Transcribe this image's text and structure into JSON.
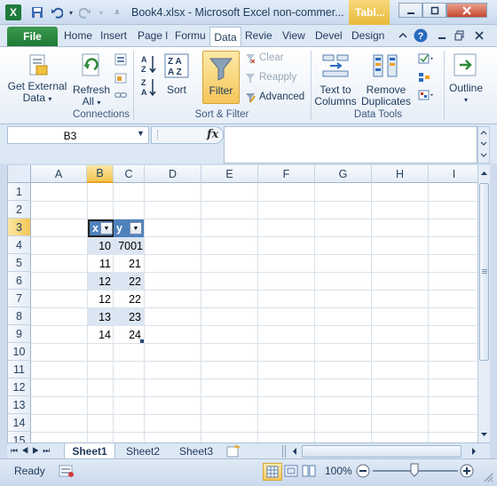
{
  "window": {
    "title": "Book4.xlsx - Microsoft Excel non-commer...",
    "context_tab": "Tabl...",
    "app_icon_letter": "X"
  },
  "tabs": {
    "file": "File",
    "items": [
      "Home",
      "Insert",
      "Page l",
      "Formu",
      "Data",
      "Revie",
      "View",
      "Devel",
      "Design"
    ],
    "active": "Data"
  },
  "ribbon": {
    "connections": {
      "get_external_data_1": "Get External",
      "get_external_data_2": "Data",
      "refresh_all_1": "Refresh",
      "refresh_all_2": "All",
      "label": "Connections"
    },
    "sort_filter": {
      "sort": "Sort",
      "filter": "Filter",
      "clear": "Clear",
      "reapply": "Reapply",
      "advanced": "Advanced",
      "label": "Sort & Filter"
    },
    "data_tools": {
      "text_to_columns_1": "Text to",
      "text_to_columns_2": "Columns",
      "remove_duplicates_1": "Remove",
      "remove_duplicates_2": "Duplicates",
      "label": "Data Tools"
    },
    "outline": {
      "label": "Outline"
    }
  },
  "formula_bar": {
    "name_box": "B3",
    "fx": "fx",
    "formula": ""
  },
  "grid": {
    "columns": [
      "A",
      "B",
      "C",
      "D",
      "E",
      "F",
      "G",
      "H",
      "I"
    ],
    "rows": [
      "1",
      "2",
      "3",
      "4",
      "5",
      "6",
      "7",
      "8",
      "9",
      "10",
      "11",
      "12",
      "13",
      "14",
      "15"
    ],
    "selected_column": "B",
    "selected_row": "3",
    "table": {
      "headers": [
        "x",
        "y"
      ],
      "x_values": [
        "10",
        "11",
        "12",
        "12",
        "13",
        "14"
      ],
      "y_values": [
        "7001",
        "21",
        "22",
        "22",
        "23",
        "24"
      ]
    }
  },
  "sheets": {
    "tabs": [
      "Sheet1",
      "Sheet2",
      "Sheet3"
    ],
    "active": "Sheet1"
  },
  "status": {
    "mode": "Ready",
    "zoom": "100%"
  },
  "colors": {
    "table_header": "#4f81bd",
    "table_band": "#dce6f2",
    "file_tab": "#207a35",
    "context_tab": "#e9b93a"
  }
}
